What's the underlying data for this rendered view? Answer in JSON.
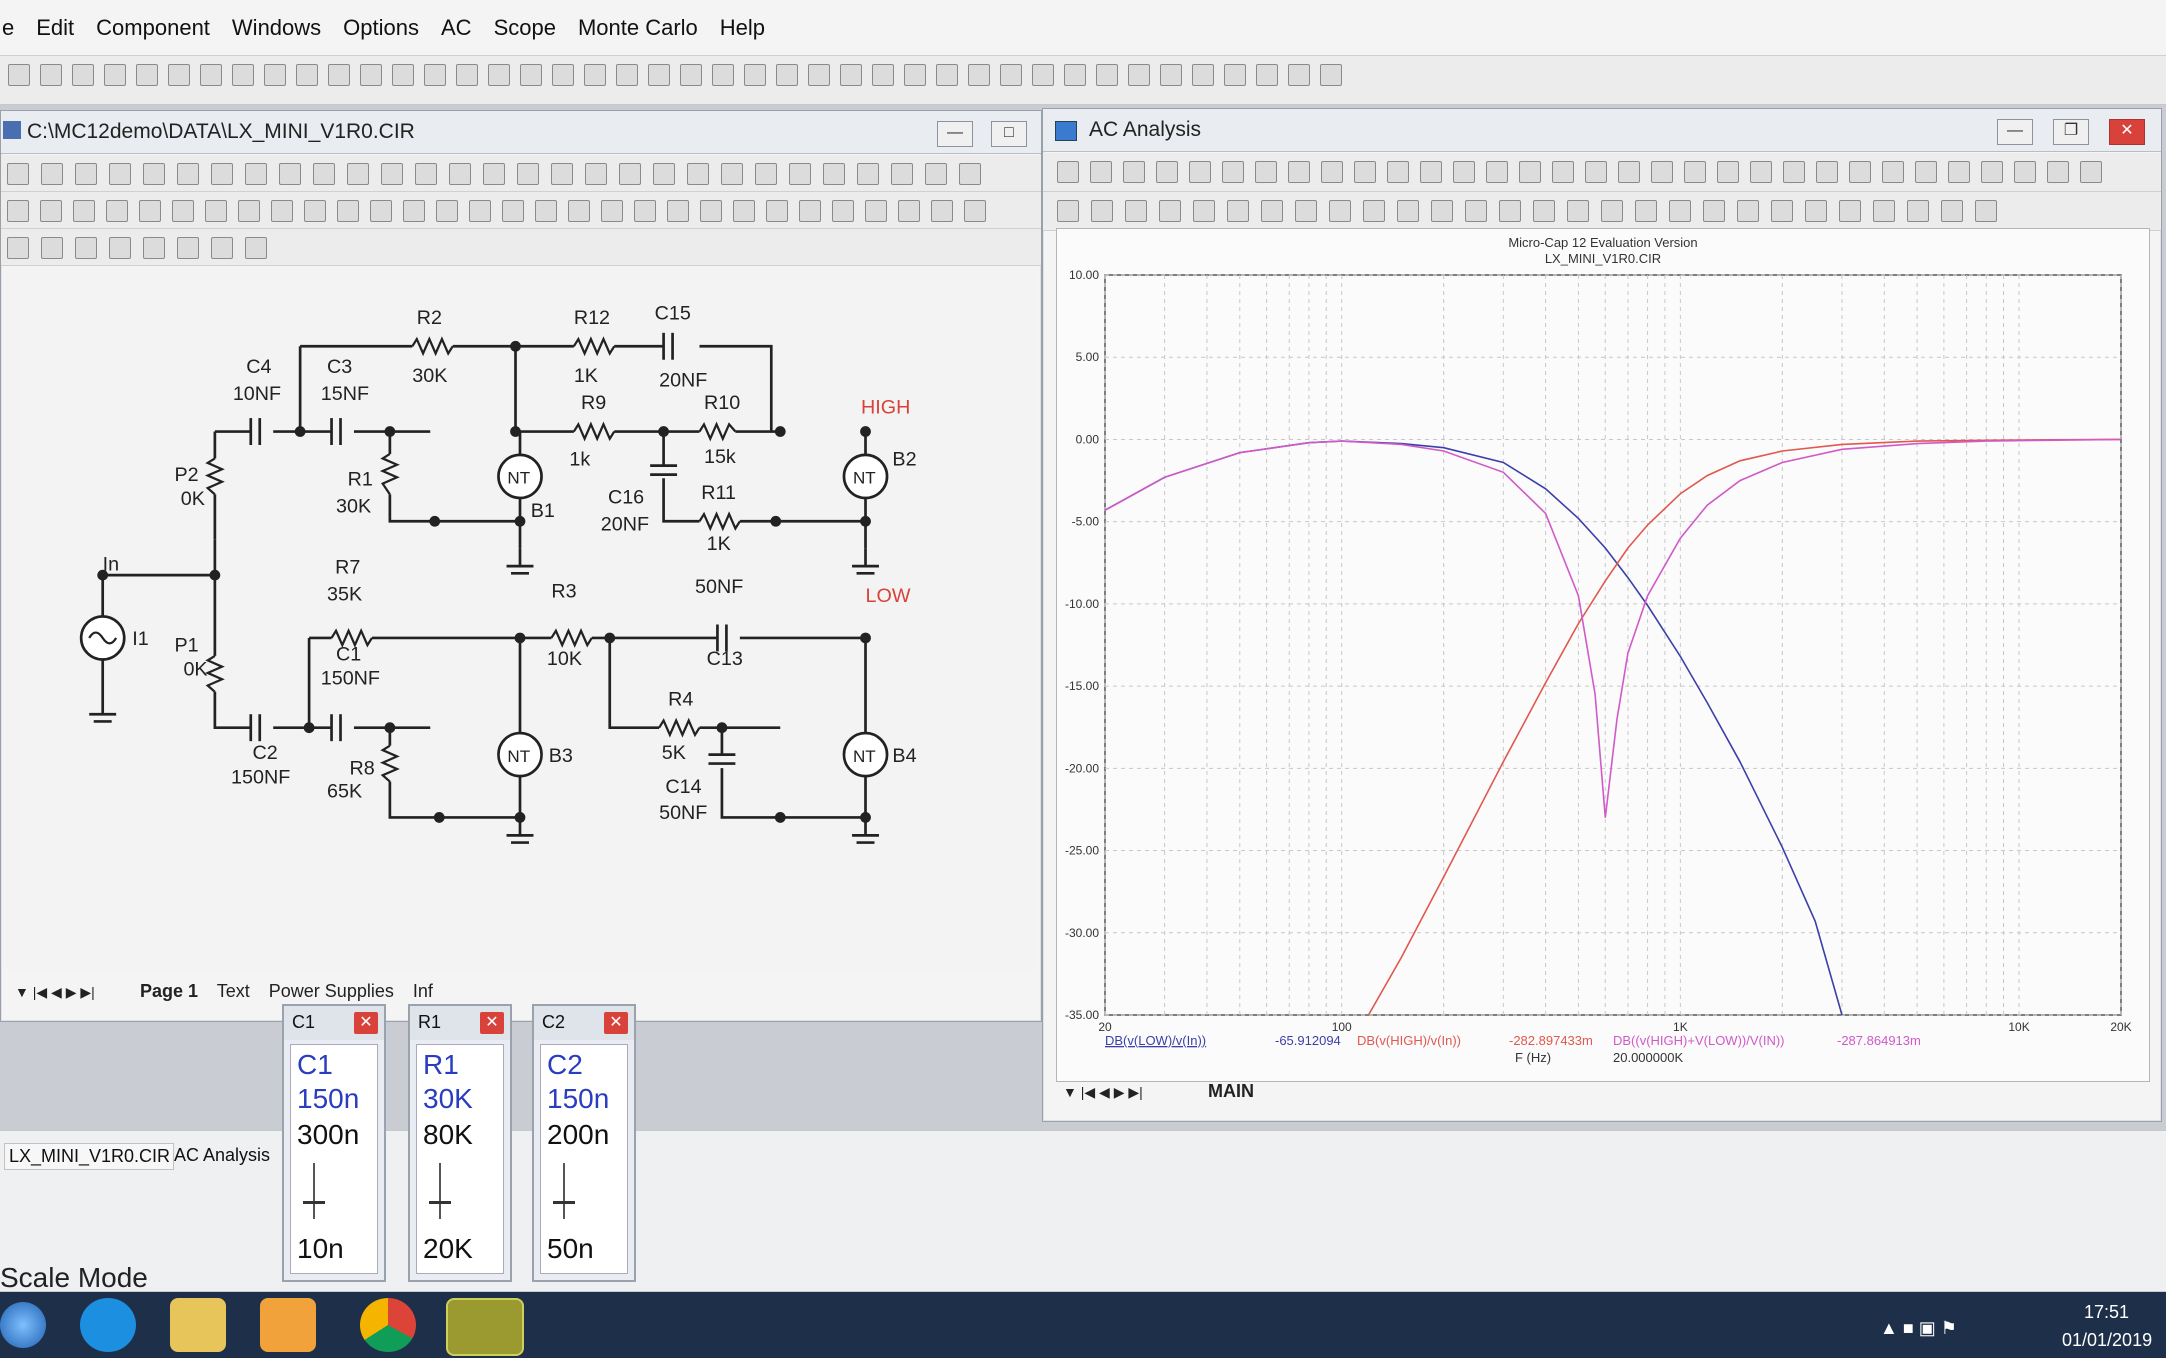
{
  "menu": [
    "e",
    "Edit",
    "Component",
    "Windows",
    "Options",
    "AC",
    "Scope",
    "Monte Carlo",
    "Help"
  ],
  "schematic_window": {
    "title": "C:\\MC12demo\\DATA\\LX_MINI_V1R0.CIR",
    "tabs": [
      "Page 1",
      "Text",
      "Power Supplies",
      "Inf"
    ]
  },
  "ac_window": {
    "title": "AC Analysis",
    "tab": "MAIN"
  },
  "schematic": {
    "labels": [
      {
        "id": "r2",
        "text": "R2"
      },
      {
        "id": "r2v",
        "text": "30K"
      },
      {
        "id": "r12",
        "text": "R12"
      },
      {
        "id": "r12v",
        "text": "1K"
      },
      {
        "id": "c15",
        "text": "C15"
      },
      {
        "id": "c15v",
        "text": "20NF"
      },
      {
        "id": "c4",
        "text": "C4"
      },
      {
        "id": "c4v",
        "text": "10NF"
      },
      {
        "id": "c3",
        "text": "C3"
      },
      {
        "id": "c3v",
        "text": "15NF"
      },
      {
        "id": "r9",
        "text": "R9"
      },
      {
        "id": "r9v",
        "text": "1k"
      },
      {
        "id": "r10",
        "text": "R10"
      },
      {
        "id": "r10v",
        "text": "15k"
      },
      {
        "id": "high",
        "text": "HIGH"
      },
      {
        "id": "p2",
        "text": "P2"
      },
      {
        "id": "p2v",
        "text": "0K"
      },
      {
        "id": "r1",
        "text": "R1"
      },
      {
        "id": "r1v",
        "text": "30K"
      },
      {
        "id": "b1",
        "text": "B1"
      },
      {
        "id": "c16",
        "text": "C16"
      },
      {
        "id": "c16v",
        "text": "20NF"
      },
      {
        "id": "r11",
        "text": "R11"
      },
      {
        "id": "r11v",
        "text": "1K"
      },
      {
        "id": "b2",
        "text": "B2"
      },
      {
        "id": "in",
        "text": "In"
      },
      {
        "id": "i1",
        "text": "I1"
      },
      {
        "id": "r7",
        "text": "R7"
      },
      {
        "id": "r7v",
        "text": "35K"
      },
      {
        "id": "r3",
        "text": "R3"
      },
      {
        "id": "r3v",
        "text": "10K"
      },
      {
        "id": "c13v",
        "text": "50NF"
      },
      {
        "id": "c13",
        "text": "C13"
      },
      {
        "id": "low",
        "text": "LOW"
      },
      {
        "id": "p1",
        "text": "P1"
      },
      {
        "id": "p1v",
        "text": "0K"
      },
      {
        "id": "c1",
        "text": "C1"
      },
      {
        "id": "c1v",
        "text": "150NF"
      },
      {
        "id": "r4",
        "text": "R4"
      },
      {
        "id": "r4v",
        "text": "5K"
      },
      {
        "id": "c2",
        "text": "C2"
      },
      {
        "id": "c2v",
        "text": "150NF"
      },
      {
        "id": "r8",
        "text": "R8"
      },
      {
        "id": "r8v",
        "text": "65K"
      },
      {
        "id": "b3",
        "text": "B3"
      },
      {
        "id": "c14",
        "text": "C14"
      },
      {
        "id": "c14v",
        "text": "50NF"
      },
      {
        "id": "b4",
        "text": "B4"
      },
      {
        "id": "nt1",
        "text": "NT"
      },
      {
        "id": "nt2",
        "text": "NT"
      },
      {
        "id": "nt3",
        "text": "NT"
      },
      {
        "id": "nt4",
        "text": "NT"
      }
    ]
  },
  "plot_header": {
    "line1": "Micro-Cap 12 Evaluation Version",
    "line2": "LX_MINI_V1R0.CIR"
  },
  "plot_footer": {
    "expr1": "DB(v(LOW)/v(In))",
    "val1": "-65.912094",
    "expr2": "DB(v(HIGH)/v(In))",
    "val2": "-282.897433m",
    "expr3": "DB((v(HIGH)+V(LOW))/V(IN))",
    "val3": "-287.864913m",
    "xunit": "F (Hz)",
    "xval": "20.000000K"
  },
  "chart_data": {
    "type": "line",
    "title": "",
    "xlabel": "F (Hz)",
    "ylabel": "",
    "xscale": "log",
    "xlim": [
      20,
      20000
    ],
    "ylim": [
      -35,
      10
    ],
    "xticks": [
      {
        "v": 20,
        "label": "20"
      },
      {
        "v": 100,
        "label": "100"
      },
      {
        "v": 1000,
        "label": "1K"
      },
      {
        "v": 10000,
        "label": "10K"
      },
      {
        "v": 20000,
        "label": "20K"
      }
    ],
    "yticks": [
      {
        "v": 10,
        "label": "10.00"
      },
      {
        "v": 5,
        "label": "5.00"
      },
      {
        "v": 0,
        "label": "0.00"
      },
      {
        "v": -5,
        "label": "-5.00"
      },
      {
        "v": -10,
        "label": "-10.00"
      },
      {
        "v": -15,
        "label": "-15.00"
      },
      {
        "v": -20,
        "label": "-20.00"
      },
      {
        "v": -25,
        "label": "-25.00"
      },
      {
        "v": -30,
        "label": "-30.00"
      },
      {
        "v": -35,
        "label": "-35.00"
      }
    ],
    "grid": true,
    "series": [
      {
        "name": "DB(v(LOW)/v(In))",
        "color": "#3b3fa8",
        "x": [
          20,
          30,
          50,
          80,
          100,
          150,
          200,
          300,
          400,
          500,
          600,
          700,
          800,
          1000,
          1200,
          1500,
          2000,
          2500,
          3000
        ],
        "y": [
          -4.3,
          -2.3,
          -0.8,
          -0.2,
          -0.1,
          -0.25,
          -0.5,
          -1.4,
          -3.0,
          -4.8,
          -6.6,
          -8.4,
          -10.1,
          -13.2,
          -16.0,
          -19.6,
          -24.8,
          -29.3,
          -35
        ]
      },
      {
        "name": "DB(v(HIGH)/v(In))",
        "color": "#e0584f",
        "x": [
          120,
          150,
          200,
          300,
          400,
          500,
          600,
          700,
          800,
          1000,
          1200,
          1500,
          2000,
          3000,
          5000,
          8000,
          12000,
          20000
        ],
        "y": [
          -35,
          -31.5,
          -26.6,
          -19.6,
          -14.8,
          -11.2,
          -8.6,
          -6.6,
          -5.2,
          -3.3,
          -2.2,
          -1.3,
          -0.7,
          -0.3,
          -0.1,
          -0.05,
          -0.02,
          0
        ]
      },
      {
        "name": "DB((v(HIGH)+V(LOW))/V(IN))",
        "color": "#d05ac8",
        "x": [
          20,
          30,
          50,
          80,
          100,
          150,
          200,
          300,
          400,
          500,
          560,
          600,
          650,
          700,
          800,
          1000,
          1200,
          1500,
          2000,
          3000,
          5000,
          8000,
          12000,
          20000
        ],
        "y": [
          -4.3,
          -2.3,
          -0.8,
          -0.2,
          -0.1,
          -0.3,
          -0.7,
          -2.0,
          -4.5,
          -9.5,
          -15.5,
          -23.0,
          -17.0,
          -13.0,
          -9.5,
          -6.0,
          -4.0,
          -2.5,
          -1.4,
          -0.6,
          -0.25,
          -0.1,
          -0.05,
          0
        ]
      }
    ]
  },
  "popups": [
    {
      "title": "C1",
      "l1": "C1",
      "l2": "150n",
      "l3": "300n",
      "l4": "10n"
    },
    {
      "title": "R1",
      "l1": "R1",
      "l2": "30K",
      "l3": "80K",
      "l4": "20K"
    },
    {
      "title": "C2",
      "l1": "C2",
      "l2": "150n",
      "l3": "200n",
      "l4": "50n"
    }
  ],
  "bottom_tabs": [
    "LX_MINI_V1R0.CIR",
    "AC Analysis"
  ],
  "status": "Scale Mode",
  "clock": {
    "time": "17:51",
    "date": "01/01/2019"
  },
  "colors": {
    "accent": "#3b3fa8",
    "red": "#d9423a",
    "high_label": "#d9423a"
  }
}
